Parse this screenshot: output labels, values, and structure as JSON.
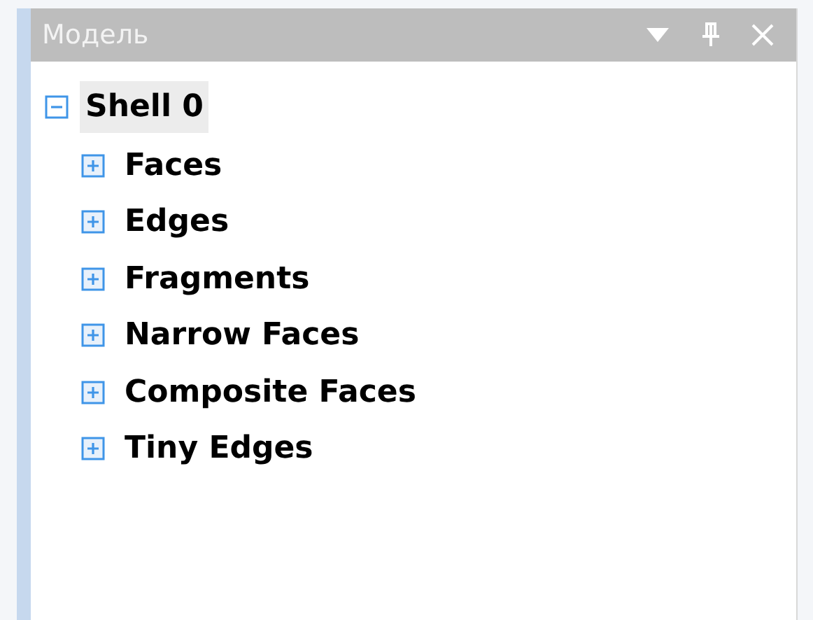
{
  "panel": {
    "title": "Модель"
  },
  "tree": [
    {
      "label": "Shell 0",
      "expanded": true,
      "selected": true,
      "children": [
        {
          "label": "Faces",
          "expanded": false,
          "selected": false
        },
        {
          "label": "Edges",
          "expanded": false,
          "selected": false
        },
        {
          "label": "Fragments",
          "expanded": false,
          "selected": false
        },
        {
          "label": "Narrow Faces",
          "expanded": false,
          "selected": false
        },
        {
          "label": "Composite Faces",
          "expanded": false,
          "selected": false
        },
        {
          "label": "Tiny Edges",
          "expanded": false,
          "selected": false
        }
      ]
    }
  ]
}
